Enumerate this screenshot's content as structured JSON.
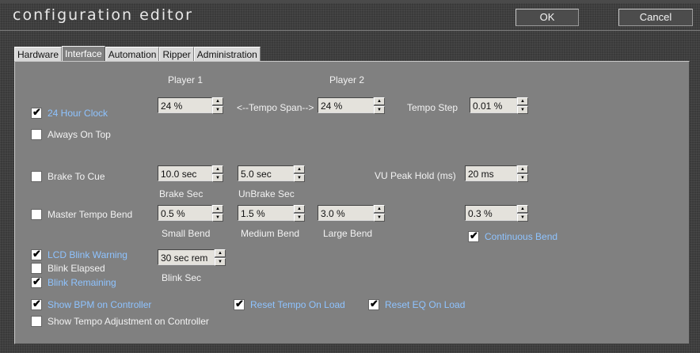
{
  "window": {
    "title": "configuration editor",
    "ok_label": "OK",
    "cancel_label": "Cancel"
  },
  "tabs": [
    {
      "label": "Hardware",
      "active": false
    },
    {
      "label": "Interface",
      "active": true
    },
    {
      "label": "Automation",
      "active": false
    },
    {
      "label": "Ripper",
      "active": false
    },
    {
      "label": "Administration",
      "active": false
    }
  ],
  "interface": {
    "player1_heading": "Player 1",
    "player2_heading": "Player 2",
    "hour_clock": {
      "label": "24 Hour Clock",
      "checked": true
    },
    "always_on_top": {
      "label": "Always On Top",
      "checked": false
    },
    "player1_tempo": "24 %",
    "tempo_span_label": "<--Tempo Span-->",
    "player2_tempo": "24 %",
    "tempo_step_label": "Tempo Step",
    "tempo_step_value": "0.01 %",
    "brake_to_cue": {
      "label": "Brake To Cue",
      "checked": false
    },
    "brake_sec_value": "10.0 sec",
    "brake_sec_label": "Brake Sec",
    "unbrake_sec_value": "5.0 sec",
    "unbrake_sec_label": "UnBrake Sec",
    "vu_peak_label": "VU Peak Hold (ms)",
    "vu_peak_value": "20 ms",
    "master_tempo_bend": {
      "label": "Master Tempo Bend",
      "checked": false
    },
    "small_bend_value": "0.5 %",
    "small_bend_label": "Small Bend",
    "medium_bend_value": "1.5 %",
    "medium_bend_label": "Medium Bend",
    "large_bend_value": "3.0 %",
    "large_bend_label": "Large Bend",
    "continuous_bend_value": "0.3 %",
    "continuous_bend": {
      "label": "Continuous Bend",
      "checked": true
    },
    "lcd_blink_warning": {
      "label": "LCD Blink Warning",
      "checked": true
    },
    "blink_elapsed": {
      "label": "Blink Elapsed",
      "checked": false
    },
    "blink_remaining": {
      "label": "Blink Remaining",
      "checked": true
    },
    "blink_sec_value": "30 sec rem",
    "blink_sec_label": "Blink Sec",
    "show_bpm": {
      "label": "Show BPM on Controller",
      "checked": true
    },
    "reset_tempo": {
      "label": "Reset Tempo On Load",
      "checked": true
    },
    "reset_eq": {
      "label": "Reset EQ On Load",
      "checked": true
    },
    "show_tempo_adj": {
      "label": "Show Tempo Adjustment on Controller",
      "checked": false
    }
  },
  "colors": {
    "panel": "#808080",
    "enabled_option_text": "#8ec3ff",
    "window_bg": "#3a3a3a"
  }
}
